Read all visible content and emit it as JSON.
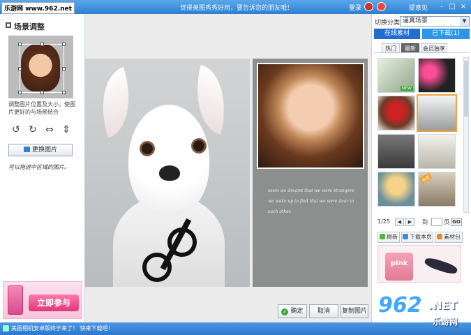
{
  "titlebar": {
    "site_tag": "乐游网 www.962.net",
    "title": "觉得美图秀秀好用，要告诉您的朋友哦！",
    "login": "登录",
    "feedback": "提意见",
    "controls": [
      "-",
      "□",
      "×"
    ]
  },
  "left": {
    "title": "场景调整",
    "hint1": "调整图片位置及大小，使图片更好的与场景结合",
    "tools": [
      "↺",
      "↻",
      "⇔",
      "⇕"
    ],
    "change_image": "更换图片",
    "hint2": "可以拖进中区域的图片。",
    "ad_button": "立即参与"
  },
  "canvas": {
    "poem": [
      "seem we dreamt that we were strangers",
      "we wake up to find that we were dear to",
      "each other."
    ],
    "buttons": {
      "ok": "确定",
      "cancel": "取消",
      "copy": "复制图片"
    }
  },
  "right": {
    "category_label": "切换分类",
    "category_value": "逼真场景",
    "tabs": [
      "在线素材",
      "已下载(1)"
    ],
    "sub_tabs": [
      "热门",
      "最新",
      "会员独享"
    ],
    "active_sub_tab": "最新",
    "badges": [
      "NEW",
      "会员"
    ],
    "pager": {
      "page": "1/25",
      "goto": "到",
      "unit": "页",
      "go": "GO"
    },
    "actions": [
      "刷新",
      "下载本页",
      "素材包"
    ],
    "promo_text": "pink"
  },
  "statusbar": {
    "text": "美图相机安卓版终于来了！ 快来下载吧！"
  },
  "watermark": {
    "num": "962",
    "net": ".NET",
    "sub": "乐游网"
  },
  "colors": {
    "titlebar": "#2f7fd2",
    "tab_active": "#1e6fd1",
    "ok_green": "#3aa33a",
    "ad_pink": "#e0377a"
  }
}
